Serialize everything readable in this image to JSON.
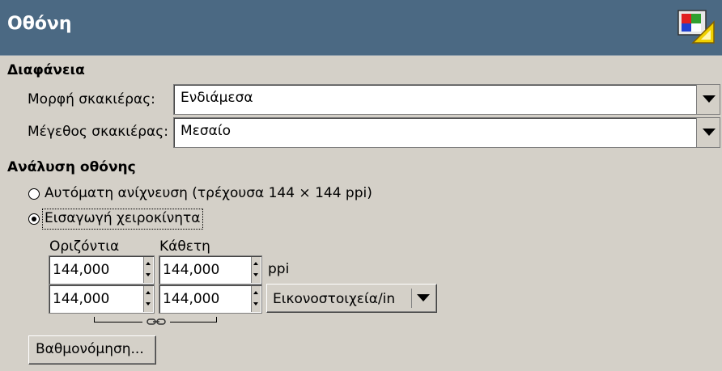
{
  "header": {
    "title": "Οθόνη",
    "icon": "display-icon"
  },
  "transparency": {
    "section_title": "Διαφάνεια",
    "check_style_label": "Μορφή σκακιέρας:",
    "check_style_value": "Ενδιάμεσα",
    "check_size_label": "Μέγεθος σκακιέρας:",
    "check_size_value": "Μεσαίο"
  },
  "resolution": {
    "section_title": "Ανάλυση οθόνης",
    "auto_detect_label": "Αυτόματη ανίχνευση (τρέχουσα 144 × 144 ppi)",
    "auto_detect_selected": false,
    "manual_label": "Εισαγωγή χειροκίνητα",
    "manual_selected": true,
    "horizontal_label": "Οριζόντια",
    "vertical_label": "Κάθετη",
    "row1": {
      "horizontal": "144,000",
      "vertical": "144,000",
      "unit": "ppi"
    },
    "row2": {
      "horizontal": "144,000",
      "vertical": "144,000",
      "unit_select": "Εικονοστοιχεία/in"
    },
    "calibrate_label": "Βαθμονόμηση..."
  },
  "colors": {
    "header_bg": "#4b6983",
    "window_bg": "#d4d0c8"
  }
}
